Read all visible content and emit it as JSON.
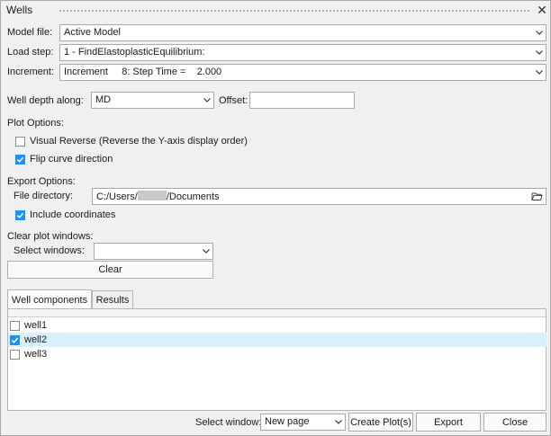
{
  "window": {
    "title": "Wells"
  },
  "model_file": {
    "label": "Model file:",
    "value": "Active Model"
  },
  "load_step": {
    "label": "Load step:",
    "value": "1 - FindElastoplasticEquilibrium:"
  },
  "increment": {
    "label": "Increment:",
    "value": "Increment     8: Step Time =    2.000"
  },
  "well_depth": {
    "label": "Well depth along:",
    "value": "MD",
    "offset_label": "Offset:",
    "offset_value": ""
  },
  "plot_options": {
    "heading": "Plot Options:",
    "visual_reverse": {
      "label": "Visual Reverse (Reverse the Y-axis display order)",
      "checked": false
    },
    "flip_curve": {
      "label": "Flip curve direction",
      "checked": true
    }
  },
  "export_options": {
    "heading": "Export Options:",
    "dir_label": "File directory:",
    "path_prefix": "C:/Users/",
    "path_suffix": "/Documents",
    "include_coords": {
      "label": "Include coordinates",
      "checked": true
    }
  },
  "clear_plot": {
    "heading": "Clear plot windows:",
    "select_label": "Select windows:",
    "select_value": "",
    "clear_label": "Clear"
  },
  "tabs": [
    {
      "label": "Well components",
      "active": true
    },
    {
      "label": "Results",
      "active": false
    }
  ],
  "wells": [
    {
      "label": "well1",
      "checked": false,
      "selected": false
    },
    {
      "label": "well2",
      "checked": true,
      "selected": true
    },
    {
      "label": "well3",
      "checked": false,
      "selected": false
    }
  ],
  "footer": {
    "select_window_label": "Select window:",
    "select_window_value": "New page",
    "create_plot_label": "Create Plot(s)",
    "export_label": "Export",
    "close_label": "Close"
  },
  "icons": {
    "dropdown": "chevron-down-icon",
    "folder": "folder-open-icon",
    "check": "checkmark-icon",
    "close": "close-icon"
  },
  "colors": {
    "check_accent": "#1e90ff",
    "selected_row": "#d9f0fb"
  }
}
